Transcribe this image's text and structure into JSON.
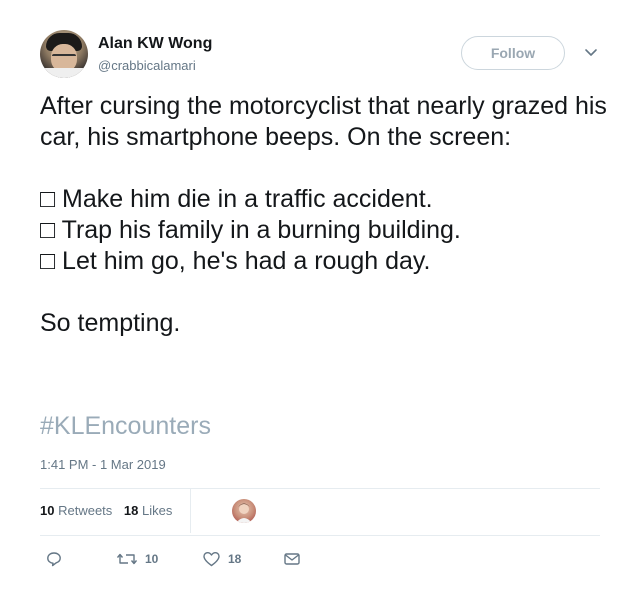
{
  "tweet": {
    "display_name": "Alan KW Wong",
    "username": "@crabbicalamari",
    "follow_label": "Follow",
    "text": "After cursing the motorcyclist that nearly grazed his car, his smartphone beeps. On the screen:\n\n□ Make him die in a traffic accident.\n□ Trap his family in a burning building.\n□ Let him go, he's had a rough day.\n\nSo tempting.",
    "hashtag": "#KLEncounters",
    "timestamp": "1:41 PM - 1 Mar 2019"
  },
  "stats": {
    "retweets_count": "10",
    "retweets_label": "Retweets",
    "likes_count": "18",
    "likes_label": "Likes"
  },
  "actions": {
    "reply_icon": "reply-icon",
    "retweet_icon": "retweet-icon",
    "retweet_count": "10",
    "like_icon": "heart-icon",
    "like_count": "18",
    "message_icon": "envelope-icon"
  },
  "colors": {
    "text": "#14171a",
    "muted": "#657786",
    "hashtag": "#9aabb8",
    "border": "#e6ecf0"
  }
}
